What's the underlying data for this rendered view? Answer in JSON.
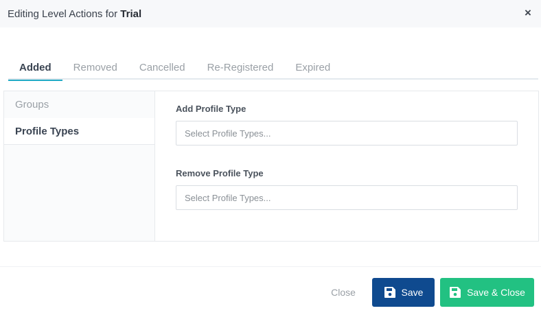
{
  "header": {
    "title_prefix": "Editing Level Actions for",
    "title_name": "Trial",
    "close_symbol": "×"
  },
  "tabs": [
    {
      "label": "Added",
      "active": true
    },
    {
      "label": "Removed",
      "active": false
    },
    {
      "label": "Cancelled",
      "active": false
    },
    {
      "label": "Re-Registered",
      "active": false
    },
    {
      "label": "Expired",
      "active": false
    }
  ],
  "sidebar": {
    "items": [
      {
        "label": "Groups",
        "active": false
      },
      {
        "label": "Profile Types",
        "active": true
      }
    ]
  },
  "form": {
    "add": {
      "label": "Add Profile Type",
      "placeholder": "Select Profile Types..."
    },
    "remove": {
      "label": "Remove Profile Type",
      "placeholder": "Select Profile Types..."
    }
  },
  "footer": {
    "close_label": "Close",
    "save_label": "Save",
    "save_close_label": "Save & Close"
  },
  "colors": {
    "tab_active_underline": "#21aac6",
    "save_button": "#0f4a8f",
    "save_close_button": "#22c182"
  },
  "icons": {
    "close": "close-icon",
    "save": "floppy-disk-icon"
  }
}
